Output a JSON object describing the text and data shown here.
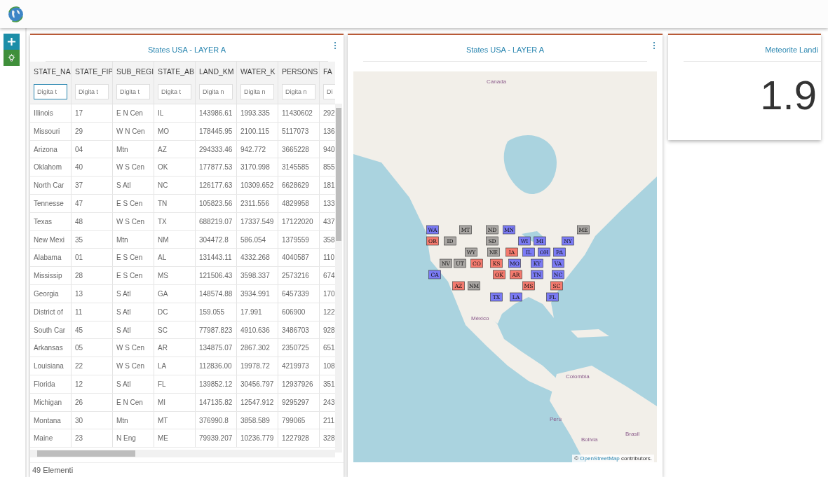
{
  "toolbar": {
    "buttons": [
      {
        "kind": "add"
      },
      {
        "kind": "light"
      }
    ]
  },
  "table_panel": {
    "title": "States USA - LAYER A",
    "columns": [
      {
        "label": "STATE_NA",
        "placeholder": "Digita t",
        "focused": true
      },
      {
        "label": "STATE_FIP",
        "placeholder": "Digita t",
        "focused": false
      },
      {
        "label": "SUB_REGI",
        "placeholder": "Digita t",
        "focused": false
      },
      {
        "label": "STATE_AB",
        "placeholder": "Digita t",
        "focused": false
      },
      {
        "label": "LAND_KM",
        "placeholder": "Digita n",
        "focused": false
      },
      {
        "label": "WATER_K",
        "placeholder": "Digita n",
        "focused": false
      },
      {
        "label": "PERSONS",
        "placeholder": "Digita n",
        "focused": false
      },
      {
        "label": "FA",
        "placeholder": "Di",
        "focused": false
      }
    ],
    "rows": [
      [
        "Illinois",
        "17",
        "E N Cen",
        "IL",
        "143986.61",
        "1993.335",
        "11430602",
        "292"
      ],
      [
        "Missouri",
        "29",
        "W N Cen",
        "MO",
        "178445.95",
        "2100.115",
        "5117073",
        "136"
      ],
      [
        "Arizona",
        "04",
        "Mtn",
        "AZ",
        "294333.46",
        "942.772",
        "3665228",
        "940"
      ],
      [
        "Oklahom",
        "40",
        "W S Cen",
        "OK",
        "177877.53",
        "3170.998",
        "3145585",
        "855"
      ],
      [
        "North Car",
        "37",
        "S Atl",
        "NC",
        "126177.63",
        "10309.652",
        "6628629",
        "181"
      ],
      [
        "Tennesse",
        "47",
        "E S Cen",
        "TN",
        "105823.56",
        "2311.556",
        "4829958",
        "133"
      ],
      [
        "Texas",
        "48",
        "W S Cen",
        "TX",
        "688219.07",
        "17337.549",
        "17122020",
        "437"
      ],
      [
        "New Mexi",
        "35",
        "Mtn",
        "NM",
        "304472.8",
        "586.054",
        "1379559",
        "358"
      ],
      [
        "Alabama",
        "01",
        "E S Cen",
        "AL",
        "131443.11",
        "4332.268",
        "4040587",
        "110"
      ],
      [
        "Mississip",
        "28",
        "E S Cen",
        "MS",
        "121506.43",
        "3598.337",
        "2573216",
        "674"
      ],
      [
        "Georgia",
        "13",
        "S Atl",
        "GA",
        "148574.88",
        "3934.991",
        "6457339",
        "170"
      ],
      [
        "District of",
        "11",
        "S Atl",
        "DC",
        "159.055",
        "17.991",
        "606900",
        "122"
      ],
      [
        "South Car",
        "45",
        "S Atl",
        "SC",
        "77987.823",
        "4910.636",
        "3486703",
        "928"
      ],
      [
        "Arkansas",
        "05",
        "W S Cen",
        "AR",
        "134875.07",
        "2867.302",
        "2350725",
        "651"
      ],
      [
        "Louisiana",
        "22",
        "W S Cen",
        "LA",
        "112836.00",
        "19978.72",
        "4219973",
        "108"
      ],
      [
        "Florida",
        "12",
        "S Atl",
        "FL",
        "139852.12",
        "30456.797",
        "12937926",
        "351"
      ],
      [
        "Michigan",
        "26",
        "E N Cen",
        "MI",
        "147135.82",
        "12547.912",
        "9295297",
        "243"
      ],
      [
        "Montana",
        "30",
        "Mtn",
        "MT",
        "376990.8",
        "3858.589",
        "799065",
        "211"
      ],
      [
        "Maine",
        "23",
        "N Eng",
        "ME",
        "79939.207",
        "10236.779",
        "1227928",
        "328"
      ]
    ],
    "footer": "49 Elementi"
  },
  "map_panel": {
    "title": "States USA - LAYER A",
    "places": [
      "Canada",
      "México",
      "Colombia",
      "Perú",
      "Bolivia",
      "Brasil"
    ],
    "states": [
      {
        "label": "WA",
        "color": "#7b7bf5"
      },
      {
        "label": "MT",
        "color": "#a9a6a3"
      },
      {
        "label": "ND",
        "color": "#a9a6a3"
      },
      {
        "label": "MN",
        "color": "#7b7bf5"
      },
      {
        "label": "ME",
        "color": "#a9a6a3"
      },
      {
        "label": "OR",
        "color": "#f47a6e"
      },
      {
        "label": "ID",
        "color": "#a9a6a3"
      },
      {
        "label": "SD",
        "color": "#a9a6a3"
      },
      {
        "label": "WI",
        "color": "#7b7bf5"
      },
      {
        "label": "MI",
        "color": "#7b7bf5"
      },
      {
        "label": "NY",
        "color": "#7b7bf5"
      },
      {
        "label": "WY",
        "color": "#a9a6a3"
      },
      {
        "label": "NE",
        "color": "#a9a6a3"
      },
      {
        "label": "IA",
        "color": "#f47a6e"
      },
      {
        "label": "IL",
        "color": "#7b7bf5"
      },
      {
        "label": "OH",
        "color": "#7b7bf5"
      },
      {
        "label": "PA",
        "color": "#7b7bf5"
      },
      {
        "label": "NV",
        "color": "#a9a6a3"
      },
      {
        "label": "UT",
        "color": "#a9a6a3"
      },
      {
        "label": "CO",
        "color": "#f47a6e"
      },
      {
        "label": "KS",
        "color": "#f47a6e"
      },
      {
        "label": "MO",
        "color": "#7b7bf5"
      },
      {
        "label": "KY",
        "color": "#7b7bf5"
      },
      {
        "label": "VA",
        "color": "#7b7bf5"
      },
      {
        "label": "CA",
        "color": "#7b7bf5"
      },
      {
        "label": "OK",
        "color": "#f47a6e"
      },
      {
        "label": "AR",
        "color": "#f47a6e"
      },
      {
        "label": "TN",
        "color": "#7b7bf5"
      },
      {
        "label": "NC",
        "color": "#7b7bf5"
      },
      {
        "label": "AZ",
        "color": "#f47a6e"
      },
      {
        "label": "NM",
        "color": "#a9a6a3"
      },
      {
        "label": "MS",
        "color": "#f47a6e"
      },
      {
        "label": "SC",
        "color": "#f47a6e"
      },
      {
        "label": "TX",
        "color": "#7b7bf5"
      },
      {
        "label": "LA",
        "color": "#7b7bf5"
      },
      {
        "label": "FL",
        "color": "#7b7bf5"
      }
    ],
    "attribution": {
      "prefix": "©",
      "link": "OpenStreetMap",
      "suffix": "contributors."
    }
  },
  "stat_panel": {
    "title": "Meteorite Landi",
    "value": "1.9"
  }
}
